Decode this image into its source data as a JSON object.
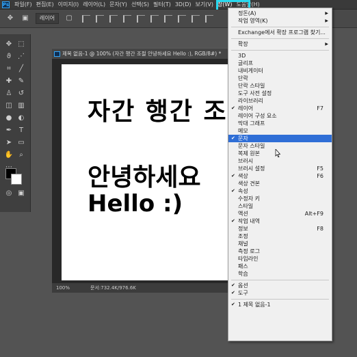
{
  "menubar": {
    "items": [
      "파일(F)",
      "편집(E)",
      "이미지(I)",
      "레이어(L)",
      "문자(Y)",
      "선택(S)",
      "필터(T)",
      "3D(D)",
      "보기(V)",
      "창(W)",
      "도움말(H)"
    ]
  },
  "options": {
    "layer_select": "레이어"
  },
  "document": {
    "tab_title": "제목 없음-1 @ 100% (자간 행간 조절  안녕하세요 Hello :), RGB/8#) *",
    "zoom": "100%",
    "doc_size": "문서:732.4K/976.6K",
    "canvas_lines": [
      "자간 행간 조",
      "안녕하세요",
      "Hello :)"
    ]
  },
  "window_menu": {
    "items": [
      {
        "label": "정돈(A)",
        "check": false,
        "shortcut": "",
        "submenu": true
      },
      {
        "label": "작업 영역(K)",
        "check": false,
        "shortcut": "",
        "submenu": true
      },
      {
        "label": "Exchange에서 확장 프로그램 찾기...",
        "check": false,
        "shortcut": "",
        "submenu": false
      },
      {
        "label": "확장",
        "check": false,
        "shortcut": "",
        "submenu": true
      },
      {
        "label": "3D",
        "check": false,
        "shortcut": "",
        "submenu": false
      },
      {
        "label": "글리프",
        "check": false,
        "shortcut": "",
        "submenu": false
      },
      {
        "label": "내비게이터",
        "check": false,
        "shortcut": "",
        "submenu": false
      },
      {
        "label": "단락",
        "check": false,
        "shortcut": "",
        "submenu": false
      },
      {
        "label": "단락 스타일",
        "check": false,
        "shortcut": "",
        "submenu": false
      },
      {
        "label": "도구 사전 설정",
        "check": false,
        "shortcut": "",
        "submenu": false
      },
      {
        "label": "라이브러리",
        "check": false,
        "shortcut": "",
        "submenu": false
      },
      {
        "label": "레이어",
        "check": true,
        "shortcut": "F7",
        "submenu": false
      },
      {
        "label": "레이어 구성 요소",
        "check": false,
        "shortcut": "",
        "submenu": false
      },
      {
        "label": "막대 그래프",
        "check": false,
        "shortcut": "",
        "submenu": false
      },
      {
        "label": "메모",
        "check": false,
        "shortcut": "",
        "submenu": false
      },
      {
        "label": "문자",
        "check": true,
        "shortcut": "",
        "submenu": false,
        "selected": true
      },
      {
        "label": "문자 스타일",
        "check": false,
        "shortcut": "",
        "submenu": false
      },
      {
        "label": "복제 원본",
        "check": false,
        "shortcut": "",
        "submenu": false
      },
      {
        "label": "브러시",
        "check": false,
        "shortcut": "",
        "submenu": false
      },
      {
        "label": "브러시 설정",
        "check": false,
        "shortcut": "F5",
        "submenu": false
      },
      {
        "label": "색상",
        "check": true,
        "shortcut": "F6",
        "submenu": false
      },
      {
        "label": "색상 견본",
        "check": false,
        "shortcut": "",
        "submenu": false
      },
      {
        "label": "속성",
        "check": true,
        "shortcut": "",
        "submenu": false
      },
      {
        "label": "수정자 키",
        "check": false,
        "shortcut": "",
        "submenu": false
      },
      {
        "label": "스타일",
        "check": false,
        "shortcut": "",
        "submenu": false
      },
      {
        "label": "액션",
        "check": false,
        "shortcut": "Alt+F9",
        "submenu": false
      },
      {
        "label": "작업 내역",
        "check": true,
        "shortcut": "",
        "submenu": false
      },
      {
        "label": "정보",
        "check": false,
        "shortcut": "F8",
        "submenu": false
      },
      {
        "label": "조정",
        "check": false,
        "shortcut": "",
        "submenu": false
      },
      {
        "label": "채널",
        "check": false,
        "shortcut": "",
        "submenu": false
      },
      {
        "label": "측정 로그",
        "check": false,
        "shortcut": "",
        "submenu": false
      },
      {
        "label": "타임라인",
        "check": false,
        "shortcut": "",
        "submenu": false
      },
      {
        "label": "패스",
        "check": false,
        "shortcut": "",
        "submenu": false
      },
      {
        "label": "학습",
        "check": false,
        "shortcut": "",
        "submenu": false
      },
      {
        "label": "옵션",
        "check": true,
        "shortcut": "",
        "submenu": false
      },
      {
        "label": "도구",
        "check": true,
        "shortcut": "",
        "submenu": false
      },
      {
        "label": "1 제목 없음-1",
        "check": true,
        "shortcut": "",
        "submenu": false
      }
    ]
  },
  "colors": {
    "accent_highlight": "#29d8ee",
    "menu_selected": "#2f6ed6"
  }
}
